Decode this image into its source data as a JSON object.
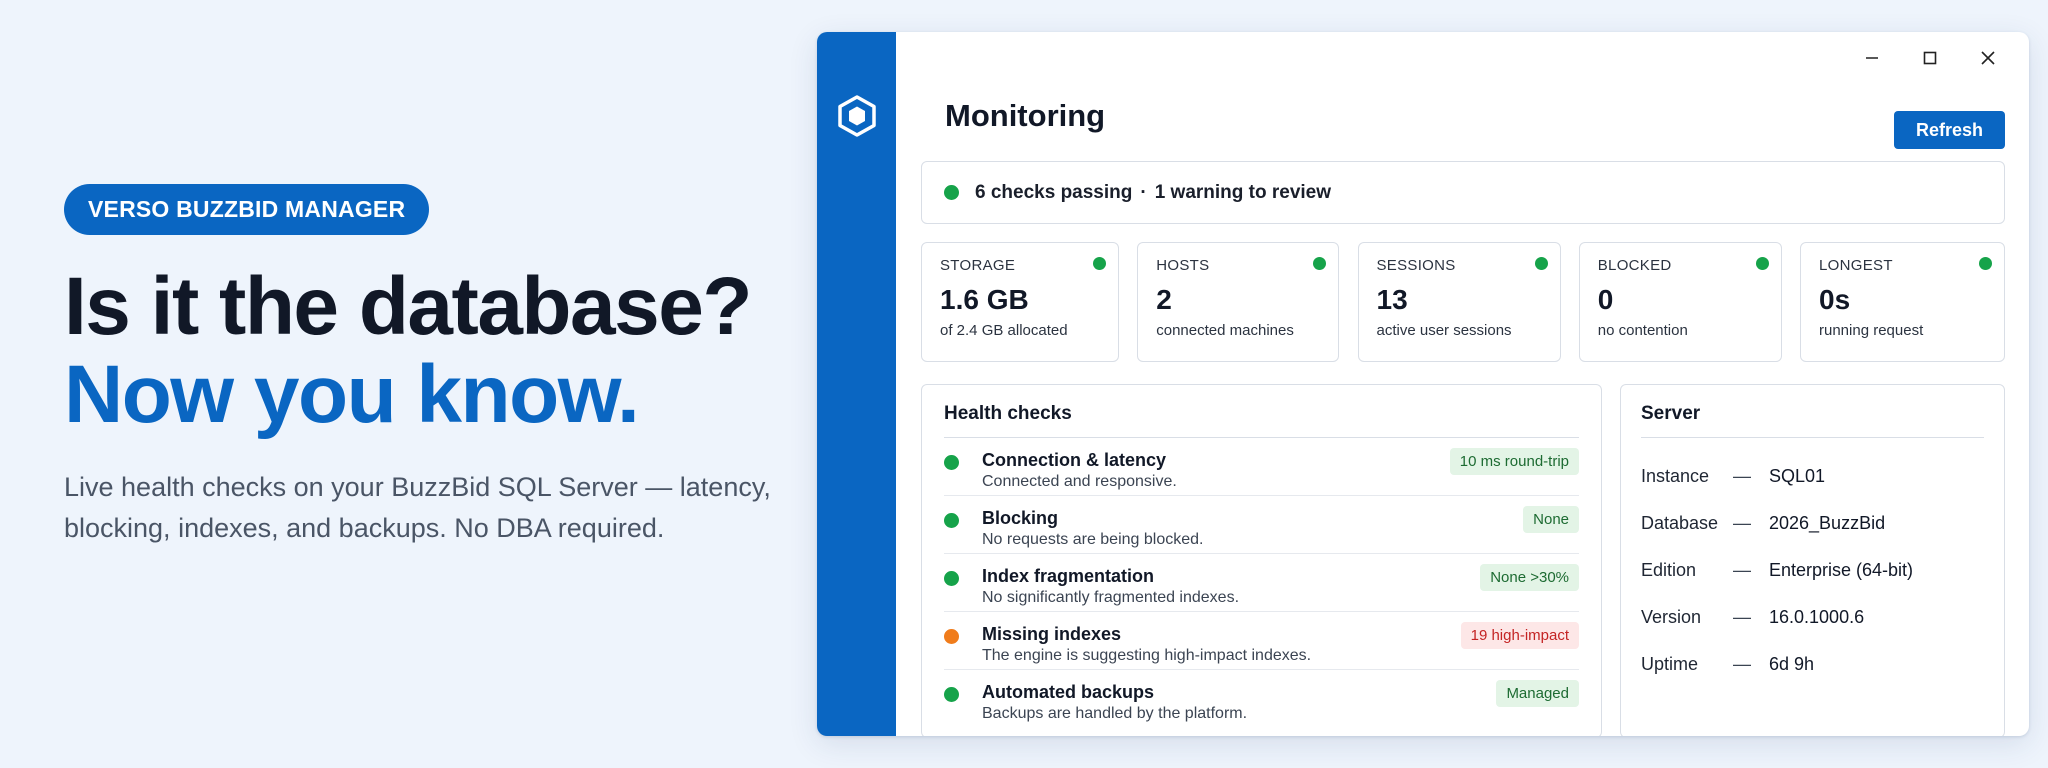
{
  "hero": {
    "badge": "VERSO BUZZBID MANAGER",
    "title_line1": "Is it the database?",
    "title_line2": "Now you know.",
    "subtitle": "Live health checks on your BuzzBid SQL Server — latency, blocking, indexes, and backups. No DBA required."
  },
  "colors": {
    "accent": "#0a66c2",
    "ok": "#16a34a",
    "warning": "#f07c1b",
    "danger_text": "#c42424"
  },
  "window": {
    "title": "Monitoring",
    "refresh_label": "Refresh",
    "controls": [
      "minimize-icon",
      "maximize-icon",
      "close-icon"
    ]
  },
  "summary": {
    "status_color": "green",
    "passing": "6 checks passing",
    "separator": "·",
    "warnings": "1 warning to review"
  },
  "stats": [
    {
      "label": "STORAGE",
      "value": "1.6 GB",
      "desc": "of 2.4 GB allocated",
      "status": "green"
    },
    {
      "label": "HOSTS",
      "value": "2",
      "desc": "connected machines",
      "status": "green"
    },
    {
      "label": "SESSIONS",
      "value": "13",
      "desc": "active user sessions",
      "status": "green"
    },
    {
      "label": "BLOCKED",
      "value": "0",
      "desc": "no contention",
      "status": "green"
    },
    {
      "label": "LONGEST",
      "value": "0s",
      "desc": "running request",
      "status": "green"
    }
  ],
  "health": {
    "title": "Health checks",
    "checks": [
      {
        "name": "Connection & latency",
        "detail": "Connected and responsive.",
        "badge": "10 ms round-trip",
        "status": "green",
        "badge_type": "ok"
      },
      {
        "name": "Blocking",
        "detail": "No requests are being blocked.",
        "badge": "None",
        "status": "green",
        "badge_type": "ok"
      },
      {
        "name": "Index fragmentation",
        "detail": "No significantly fragmented indexes.",
        "badge": "None >30%",
        "status": "green",
        "badge_type": "ok"
      },
      {
        "name": "Missing indexes",
        "detail": "The engine is suggesting high-impact indexes.",
        "badge": "19 high-impact",
        "status": "orange",
        "badge_type": "warn"
      },
      {
        "name": "Automated backups",
        "detail": "Backups are handled by the platform.",
        "badge": "Managed",
        "status": "green",
        "badge_type": "ok"
      }
    ]
  },
  "server": {
    "title": "Server",
    "dash": "—",
    "rows": [
      {
        "key": "Instance",
        "value": "SQL01"
      },
      {
        "key": "Database",
        "value": "2026_BuzzBid"
      },
      {
        "key": "Edition",
        "value": "Enterprise (64-bit)"
      },
      {
        "key": "Version",
        "value": "16.0.1000.6"
      },
      {
        "key": "Uptime",
        "value": "6d 9h"
      }
    ]
  }
}
